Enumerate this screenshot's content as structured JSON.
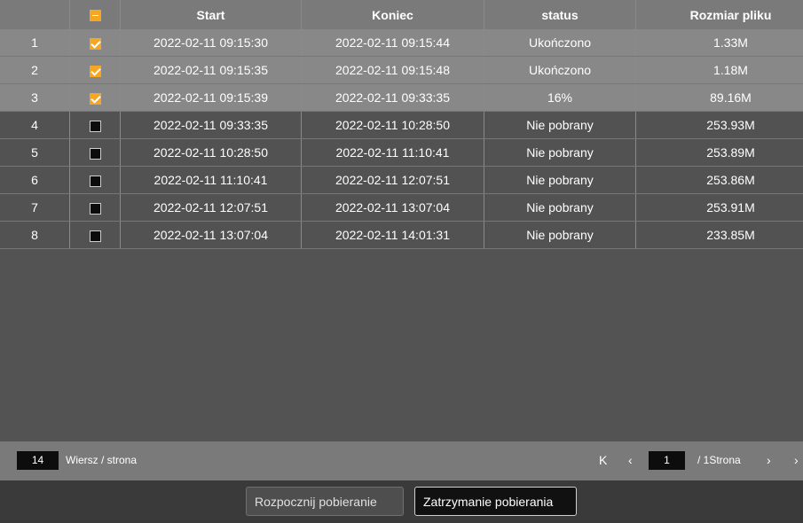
{
  "table": {
    "headers": {
      "index": "",
      "start": "Start",
      "end": "Koniec",
      "status": "status",
      "size": "Rozmiar pliku"
    },
    "rows": [
      {
        "index": "1",
        "checked": true,
        "start": "2022-02-11 09:15:30",
        "end": "2022-02-11 09:15:44",
        "status": "Ukończono",
        "size": "1.33M"
      },
      {
        "index": "2",
        "checked": true,
        "start": "2022-02-11 09:15:35",
        "end": "2022-02-11 09:15:48",
        "status": "Ukończono",
        "size": "1.18M"
      },
      {
        "index": "3",
        "checked": true,
        "start": "2022-02-11 09:15:39",
        "end": "2022-02-11 09:33:35",
        "status": "16%",
        "size": "89.16M"
      },
      {
        "index": "4",
        "checked": false,
        "start": "2022-02-11 09:33:35",
        "end": "2022-02-11 10:28:50",
        "status": "Nie pobrany",
        "size": "253.93M"
      },
      {
        "index": "5",
        "checked": false,
        "start": "2022-02-11 10:28:50",
        "end": "2022-02-11 11:10:41",
        "status": "Nie pobrany",
        "size": "253.89M"
      },
      {
        "index": "6",
        "checked": false,
        "start": "2022-02-11 11:10:41",
        "end": "2022-02-11 12:07:51",
        "status": "Nie pobrany",
        "size": "253.86M"
      },
      {
        "index": "7",
        "checked": false,
        "start": "2022-02-11 12:07:51",
        "end": "2022-02-11 13:07:04",
        "status": "Nie pobrany",
        "size": "253.91M"
      },
      {
        "index": "8",
        "checked": false,
        "start": "2022-02-11 13:07:04",
        "end": "2022-02-11 14:01:31",
        "status": "Nie pobrany",
        "size": "233.85M"
      }
    ]
  },
  "pager": {
    "rows_per_page": "14",
    "rows_per_page_label": "Wiersz / strona",
    "first_icon": "first-page-icon",
    "prev_icon": "prev-page-icon",
    "current_page": "1",
    "total_label": "/  1Strona",
    "next_icon": "next-page-icon",
    "last_icon": "last-page-icon"
  },
  "buttons": {
    "start": "Rozpocznij pobieranie",
    "stop": "Zatrzymanie pobierania"
  },
  "colors": {
    "accent": "#f5a623",
    "header_bg": "#7a7a7a",
    "row_done_bg": "#888888",
    "row_pending_bg": "#525252"
  }
}
